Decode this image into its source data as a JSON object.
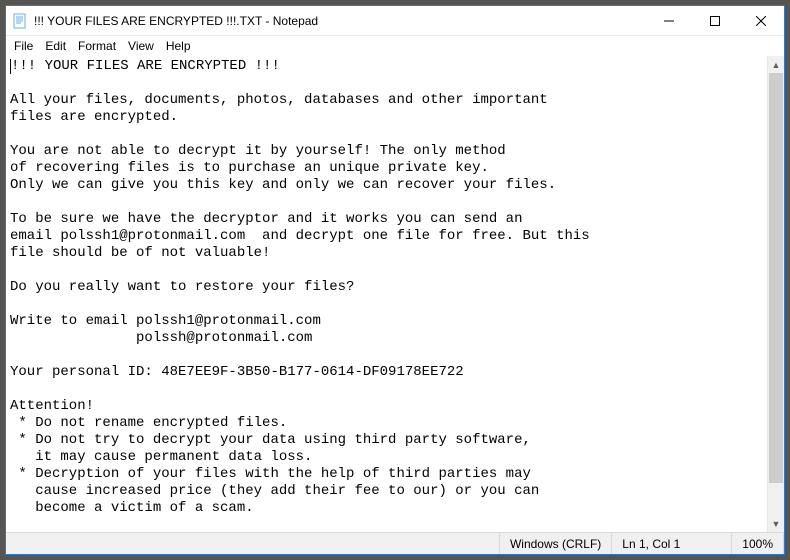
{
  "titlebar": {
    "title": "!!! YOUR FILES ARE ENCRYPTED !!!.TXT - Notepad"
  },
  "menu": {
    "file": "File",
    "edit": "Edit",
    "format": "Format",
    "view": "View",
    "help": "Help"
  },
  "document": {
    "text": "!!! YOUR FILES ARE ENCRYPTED !!!\n\nAll your files, documents, photos, databases and other important\nfiles are encrypted.\n\nYou are not able to decrypt it by yourself! The only method\nof recovering files is to purchase an unique private key.\nOnly we can give you this key and only we can recover your files.\n\nTo be sure we have the decryptor and it works you can send an\nemail polssh1@protonmail.com  and decrypt one file for free. But this\nfile should be of not valuable!\n\nDo you really want to restore your files?\n\nWrite to email polssh1@protonmail.com\n               polssh@protonmail.com\n\nYour personal ID: 48E7EE9F-3B50-B177-0614-DF09178EE722\n\nAttention!\n * Do not rename encrypted files.\n * Do not try to decrypt your data using third party software,\n   it may cause permanent data loss.\n * Decryption of your files with the help of third parties may\n   cause increased price (they add their fee to our) or you can\n   become a victim of a scam."
  },
  "statusbar": {
    "line_ending": "Windows (CRLF)",
    "position": "Ln 1, Col 1",
    "zoom": "100%"
  }
}
